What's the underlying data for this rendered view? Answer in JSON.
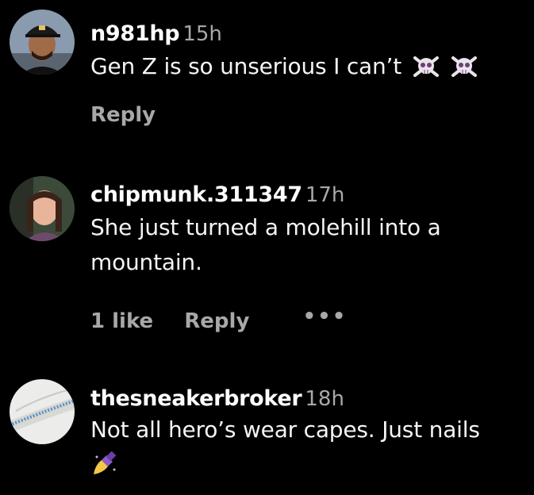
{
  "comments": [
    {
      "username": "n981hp",
      "time": "15h",
      "text": "Gen Z is so unserious I can’t",
      "emoji": [
        "skull-and-crossbones-icon",
        "skull-and-crossbones-icon"
      ],
      "actions": {
        "reply": "Reply"
      }
    },
    {
      "username": "chipmunk.311347",
      "time": "17h",
      "text_lines": [
        "She just turned a molehill into a",
        "mountain."
      ],
      "actions": {
        "likes": "1 like",
        "reply": "Reply",
        "more": "•••"
      }
    },
    {
      "username": "thesneakerbroker",
      "time": "18h",
      "text": "Not all hero’s wear capes. Just nails",
      "emoji": [
        "nail-polish-icon"
      ]
    }
  ]
}
